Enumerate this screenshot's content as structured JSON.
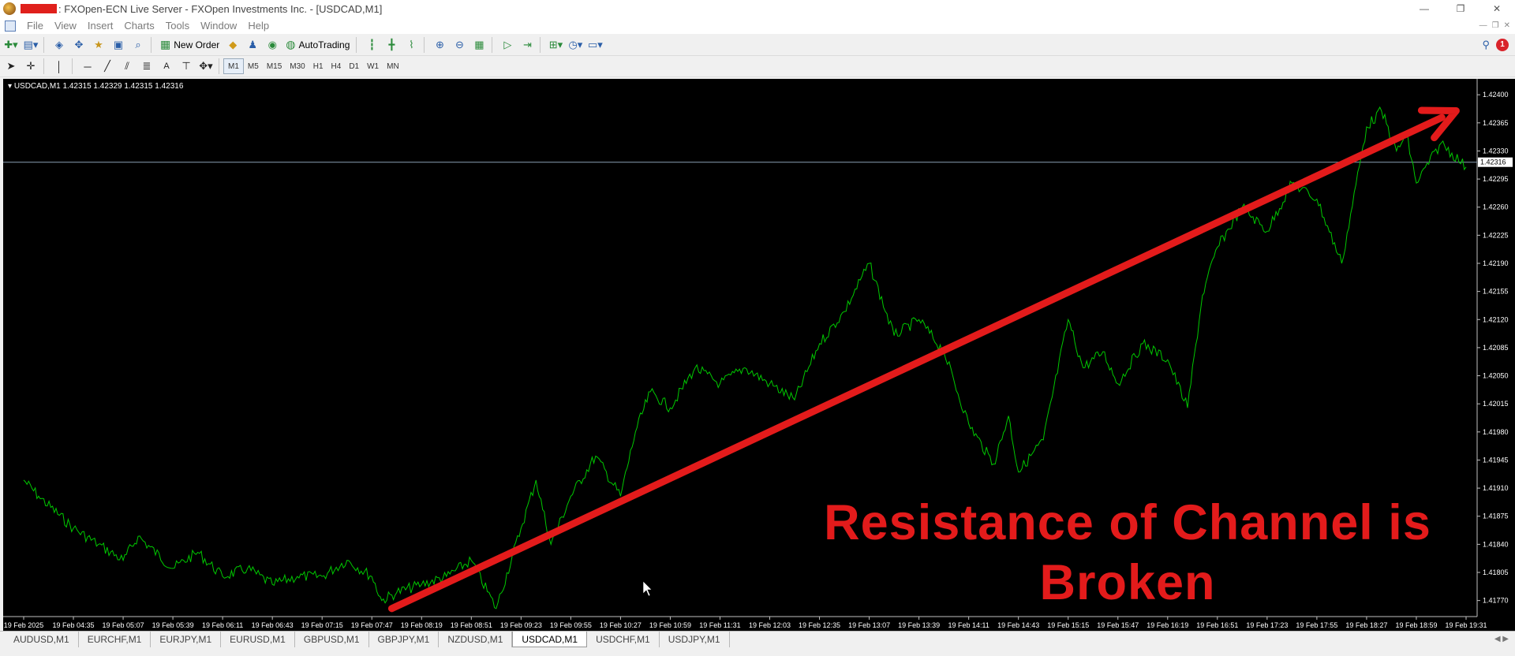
{
  "window": {
    "title": ": FXOpen-ECN Live Server - FXOpen Investments Inc. - [USDCAD,M1]",
    "controls": [
      "—",
      "❐",
      "✕"
    ]
  },
  "menu": [
    "File",
    "View",
    "Insert",
    "Charts",
    "Tools",
    "Window",
    "Help"
  ],
  "toolbar": {
    "new_order_label": "New Order",
    "autotrading_label": "AutoTrading"
  },
  "timeframes": [
    "M1",
    "M5",
    "M15",
    "M30",
    "H1",
    "H4",
    "D1",
    "W1",
    "MN"
  ],
  "active_timeframe": "M1",
  "notifications_count": "1",
  "chart": {
    "info_text": "USDCAD,M1  1.42315 1.42329 1.42315 1.42316",
    "annotation_line1": "Resistance of Channel is",
    "annotation_line2": "Broken",
    "bid_label": "1.42316"
  },
  "chart_data": {
    "type": "line",
    "symbol": "USDCAD",
    "timeframe": "M1",
    "background_color": "#000000",
    "line_color": "#00c800",
    "arrow_color": "#e31b1b",
    "bid_line_value": 1.42316,
    "ylim": [
      1.4175,
      1.4241
    ],
    "y_ticks": [
      "1.42400",
      "1.42365",
      "1.42330",
      "1.42295",
      "1.42260",
      "1.42225",
      "1.42190",
      "1.42155",
      "1.42120",
      "1.42085",
      "1.42050",
      "1.42015",
      "1.41980",
      "1.41945",
      "1.41910",
      "1.41875",
      "1.41840",
      "1.41805",
      "1.41770"
    ],
    "x_ticks": [
      "19 Feb 2025",
      "19 Feb 04:35",
      "19 Feb 05:07",
      "19 Feb 05:39",
      "19 Feb 06:11",
      "19 Feb 06:43",
      "19 Feb 07:15",
      "19 Feb 07:47",
      "19 Feb 08:19",
      "19 Feb 08:51",
      "19 Feb 09:23",
      "19 Feb 09:55",
      "19 Feb 10:27",
      "19 Feb 10:59",
      "19 Feb 11:31",
      "19 Feb 12:03",
      "19 Feb 12:35",
      "19 Feb 13:07",
      "19 Feb 13:39",
      "19 Feb 14:11",
      "19 Feb 14:43",
      "19 Feb 15:15",
      "19 Feb 15:47",
      "19 Feb 16:19",
      "19 Feb 16:51",
      "19 Feb 17:23",
      "19 Feb 17:55",
      "19 Feb 18:27",
      "19 Feb 18:59",
      "19 Feb 19:31"
    ],
    "series": [
      {
        "x": [
          0,
          0.3,
          1,
          1.5,
          2,
          2.3,
          3,
          3.5,
          4,
          4.5,
          5,
          5.5,
          6,
          6.5,
          7,
          7.2,
          7.5,
          8,
          8.5,
          9,
          9.5,
          10,
          10.3,
          10.6,
          11,
          11.5,
          12,
          12.3,
          12.6,
          13,
          13.5,
          14,
          14.5,
          15,
          15.5,
          16,
          16.5,
          17,
          17.5,
          18,
          18.5,
          19,
          19.5,
          19.8,
          20,
          20.5,
          21,
          21.3,
          21.7,
          22,
          22.5,
          23,
          23.4,
          23.7,
          24,
          24.5,
          25,
          25.5,
          26,
          26.5,
          27,
          27.3,
          27.6,
          27.8,
          28,
          28.5,
          29
        ],
        "values": [
          1.4192,
          1.419,
          1.4186,
          1.4184,
          1.4182,
          1.4185,
          1.4181,
          1.4183,
          1.418,
          1.4181,
          1.4179,
          1.418,
          1.418,
          1.4182,
          1.418,
          1.4177,
          1.4178,
          1.4179,
          1.418,
          1.4182,
          1.4176,
          1.4186,
          1.4192,
          1.4184,
          1.419,
          1.4195,
          1.419,
          1.4198,
          1.4203,
          1.4201,
          1.4206,
          1.4204,
          1.4206,
          1.4204,
          1.4202,
          1.4209,
          1.4213,
          1.4219,
          1.421,
          1.4212,
          1.4208,
          1.4199,
          1.4194,
          1.42,
          1.4193,
          1.4197,
          1.4212,
          1.4206,
          1.4208,
          1.4204,
          1.4209,
          1.4207,
          1.4201,
          1.4215,
          1.4221,
          1.4226,
          1.4223,
          1.4229,
          1.4227,
          1.4219,
          1.4236,
          1.4238,
          1.4233,
          1.4235,
          1.4229,
          1.4234,
          1.4231
        ]
      }
    ],
    "annotation_arrow": {
      "from": [
        7.4,
        1.4176
      ],
      "to": [
        28.8,
        1.4238
      ]
    }
  },
  "tabs": [
    "AUDUSD,M1",
    "EURCHF,M1",
    "EURJPY,M1",
    "EURUSD,M1",
    "GBPUSD,M1",
    "GBPJPY,M1",
    "NZDUSD,M1",
    "USDCAD,M1",
    "USDCHF,M1",
    "USDJPY,M1"
  ],
  "active_tab": "USDCAD,M1",
  "tab_nav": "◀ ▶"
}
